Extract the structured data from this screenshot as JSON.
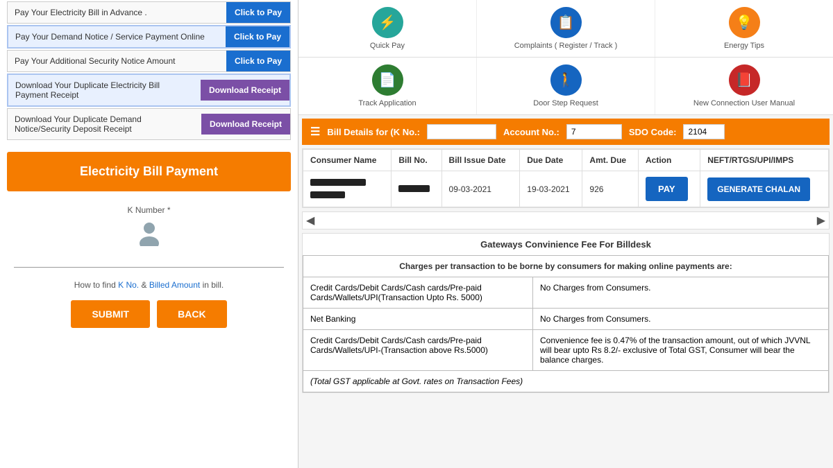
{
  "leftPanel": {
    "menuItems": [
      {
        "id": "advance",
        "text": "Pay Your Electricity Bill in Advance .",
        "btnLabel": "Click to Pay",
        "btnClass": "btn-blue"
      },
      {
        "id": "demand",
        "text": "Pay Your Demand Notice / Service Payment Online",
        "btnLabel": "Click to Pay",
        "btnClass": "btn-blue",
        "highlighted": true
      },
      {
        "id": "security",
        "text": "Pay Your Additional Security Notice Amount",
        "btnLabel": "Click to Pay",
        "btnClass": "btn-blue"
      },
      {
        "id": "dupElectricity",
        "text": "Download Your Duplicate Electricity Bill Payment Receipt",
        "btnLabel": "Download Receipt",
        "btnClass": "btn-purple",
        "highlighted": true
      },
      {
        "id": "dupDemand",
        "text": "Download Your Duplicate Demand Notice/Security Deposit Receipt",
        "btnLabel": "Download Receipt",
        "btnClass": "btn-purple"
      }
    ],
    "electricityBtnLabel": "Electricity Bill Payment",
    "kNumberLabel": "K Number *",
    "kNumberPlaceholder": "",
    "helpText": "How to find",
    "kNoLink": "K No.",
    "andText": "&",
    "billedLink": "Billed Amount",
    "inBillText": "in bill.",
    "submitLabel": "SUBMIT",
    "backLabel": "BACK"
  },
  "rightPanel": {
    "topIcons": [
      {
        "id": "quickpay",
        "label": "Quick Pay",
        "iconColor": "icon-teal",
        "iconChar": "⚡"
      },
      {
        "id": "complaints",
        "label": "Complaints ( Register / Track )",
        "iconColor": "icon-blue",
        "iconChar": "📋"
      },
      {
        "id": "energytips",
        "label": "Energy Tips",
        "iconColor": "icon-amber",
        "iconChar": "💡"
      }
    ],
    "bottomIcons": [
      {
        "id": "trackapplication",
        "label": "Track Application",
        "iconColor": "icon-green",
        "iconChar": "📄"
      },
      {
        "id": "doorstep",
        "label": "Door Step Request",
        "iconColor": "icon-blue",
        "iconChar": "🚶"
      },
      {
        "id": "newconnection",
        "label": "New Connection User Manual",
        "iconColor": "icon-red",
        "iconChar": "📕"
      }
    ],
    "billDetails": {
      "headerLabel": "Bill Details for (K No.:",
      "kNoValue": "",
      "accountLabel": "Account No.:",
      "accountValue": "7",
      "sdoLabel": "SDO Code:",
      "sdoValue": "2104",
      "columns": [
        "Consumer Name",
        "Bill No.",
        "Bill Issue Date",
        "Due Date",
        "Amt. Due",
        "Action",
        "NEFT/RTGS/UPI/IMPS"
      ],
      "row": {
        "consumerName1": "",
        "consumerName2": "",
        "billNo": "",
        "issueDate": "09-03-2021",
        "dueDate": "19-03-2021",
        "amtDue": "926",
        "payLabel": "PAY",
        "generateLabel": "GENERATE CHALAN"
      }
    },
    "gateway": {
      "title": "Gateways Convinience Fee For Billdesk",
      "headerCol1": "Charges per transaction to be borne by consumers for making online payments are:",
      "rows": [
        {
          "col1": "Credit Cards/Debit Cards/Cash cards/Pre-paid Cards/Wallets/UPI(Transaction Upto Rs. 5000)",
          "col2": "No Charges from Consumers."
        },
        {
          "col1": "Net Banking",
          "col2": "No Charges from Consumers."
        },
        {
          "col1": "Credit Cards/Debit Cards/Cash cards/Pre-paid Cards/Wallets/UPI-(Transaction above Rs.5000)",
          "col2": "Convenience fee is 0.47% of the transaction amount, out of which JVVNL will bear upto Rs 8.2/- exclusive of Total GST, Consumer will bear the balance charges."
        },
        {
          "col1": "(Total GST applicable at Govt. rates on Transaction Fees)",
          "col2": ""
        }
      ]
    }
  }
}
